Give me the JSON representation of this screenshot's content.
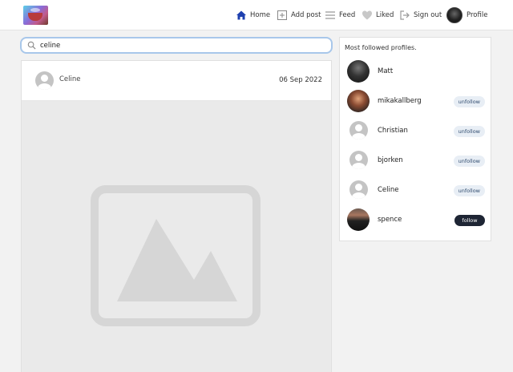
{
  "nav": {
    "home": "Home",
    "add_post": "Add post",
    "feed": "Feed",
    "liked": "Liked",
    "sign_out": "Sign out",
    "profile": "Profile",
    "accent": "#1e40af"
  },
  "search": {
    "value": "celine",
    "placeholder": ""
  },
  "post": {
    "username": "Celine",
    "date": "06 Sep 2022"
  },
  "sidebar": {
    "title": "Most followed profiles.",
    "profiles": [
      {
        "name": "Matt",
        "button": ""
      },
      {
        "name": "mikakallberg",
        "button": "unfollow"
      },
      {
        "name": "Christian",
        "button": "unfollow"
      },
      {
        "name": "bjorken",
        "button": "unfollow"
      },
      {
        "name": "Celine",
        "button": "unfollow"
      },
      {
        "name": "spence",
        "button": "follow"
      }
    ]
  }
}
